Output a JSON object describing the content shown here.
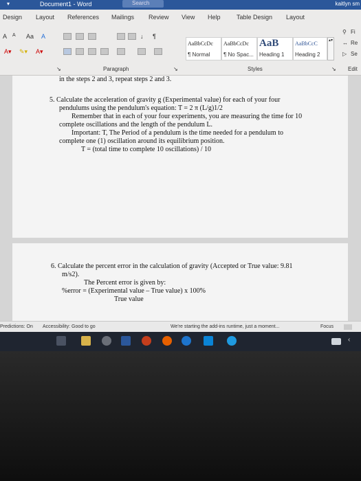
{
  "titlebar": {
    "title": "Document1  -  Word",
    "search": "Search",
    "user": "kaitlyn sm"
  },
  "ribbon": {
    "tabs": [
      "Design",
      "Layout",
      "References",
      "Mailings",
      "Review",
      "View",
      "Help",
      "Table Design",
      "Layout"
    ],
    "font_controls": [
      "A",
      "A",
      "Aa",
      "A"
    ],
    "paragraph_label": "Paragraph",
    "styles_label": "Styles",
    "edit_label": "Edit",
    "styles": [
      {
        "preview": "AaBbCcDc",
        "name": "¶ Normal"
      },
      {
        "preview": "AaBbCcDc",
        "name": "¶ No Spac..."
      },
      {
        "preview": "AaB",
        "name": "Heading 1"
      },
      {
        "preview": "AaBbCcC",
        "name": "Heading 2"
      }
    ],
    "editing": [
      "Fi",
      "Re",
      "Se"
    ]
  },
  "document": {
    "top_line": "in the steps 2 and 3, repeat steps 2 and 3.",
    "item5": {
      "l1": "5.  Calculate the acceleration of gravity g (Experimental value) for each of your four",
      "l2": "pendulums using the pendulum's equation: T = 2 π (L/g)1/2",
      "l3": "Remember that in each of your four experiments, you are measuring the time for 10",
      "l4": "complete oscillations and the length of the pendulum L.",
      "l5": "Important: T, The Period of a pendulum is the time needed for a pendulum to",
      "l6": "complete one (1) oscillation around its equilibrium position.",
      "l7": "T = (total time to complete 10 oscillations) / 10"
    },
    "item6": {
      "l1": "6.  Calculate the percent error in the calculation of gravity (Accepted or True value: 9.81",
      "l2": "m/s2).",
      "l3": "The Percent error is given by:",
      "l4": "%error = (Experimental value – True value) x 100%",
      "l5": "True value"
    }
  },
  "statusbar": {
    "predictions": "Predictions: On",
    "accessibility": "Accessibility: Good to go",
    "addins": "We're starting the add-ins runtime, just a moment...",
    "focus": "Focus"
  },
  "colors": {
    "word_blue": "#2b579a",
    "taskbar": "#1f2530"
  }
}
